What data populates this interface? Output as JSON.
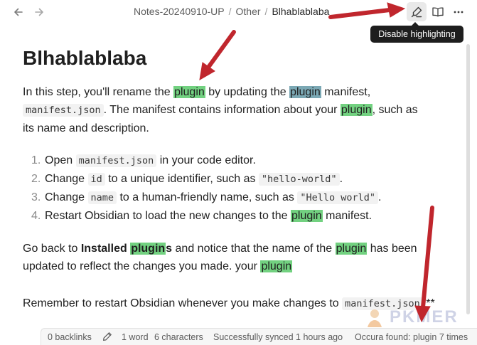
{
  "nav": {
    "back_icon": "arrow-left-icon",
    "forward_icon": "arrow-right-icon"
  },
  "breadcrumb": {
    "parts": [
      "Notes-20240910-UP",
      "Other"
    ],
    "current": "Blhablablaba",
    "separator": "/"
  },
  "toolbar": {
    "highlight_icon": "highlighter-icon",
    "reading_icon": "book-open-icon",
    "more_icon": "more-horizontal-icon",
    "tooltip": "Disable highlighting"
  },
  "document": {
    "title": "Blhablablaba",
    "paragraph1": {
      "t1": "In this step, you'll rename the ",
      "h1": "plugin",
      "t2": " by updating the ",
      "h2": "plugin",
      "t3": " manifest,",
      "code1": "manifest.json",
      "t4": ". The manifest contains information about your ",
      "h3": "plugin",
      "t5": ", such as",
      "t6": "its name and description."
    },
    "steps": [
      {
        "num": "1.",
        "a": "Open ",
        "code": "manifest.json",
        "b": " in your code editor."
      },
      {
        "num": "2.",
        "a": "Change ",
        "code": "id",
        "b": " to a unique identifier, such as ",
        "code2": "\"hello-world\"",
        "c": "."
      },
      {
        "num": "3.",
        "a": "Change ",
        "code": "name",
        "b": " to a human-friendly name, such as ",
        "code2": "\"Hello world\"",
        "c": "."
      },
      {
        "num": "4.",
        "a": "Restart Obsidian to load the new changes to the ",
        "hl": "plugin",
        "b": " manifest."
      }
    ],
    "paragraph2": {
      "t1": "Go back to ",
      "b1": "Installed ",
      "h1": "plugin",
      "b2": "s",
      "t2": " and notice that the name of the ",
      "h2": "plugin",
      "t3": " has been",
      "t4": "updated to reflect the changes you made. your ",
      "h3": "plugin"
    },
    "paragraph3": {
      "t1": "Remember to restart Obsidian whenever you make changes to ",
      "code1": "manifest.json",
      "t2": ".**"
    }
  },
  "statusbar": {
    "backlinks": "0 backlinks",
    "edit_icon": "pencil-icon",
    "words": "1 word",
    "characters": "6 characters",
    "sync": "Successfully synced 1 hours ago",
    "occura": "Occura found: plugin 7 times"
  },
  "watermark": {
    "text": "PKMER"
  },
  "colors": {
    "highlight": "#72d180",
    "selected_highlight": "#7ba8b4",
    "arrow": "#c0262d",
    "tooltip_bg": "#1e1e1e"
  }
}
